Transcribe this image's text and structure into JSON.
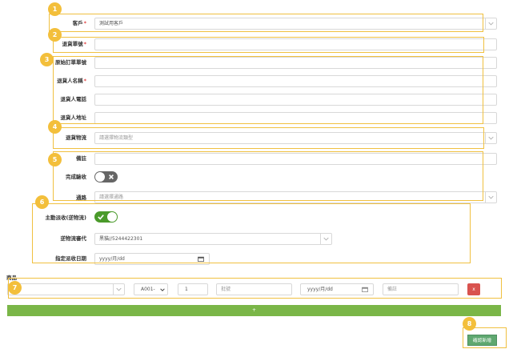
{
  "form": {
    "customer": {
      "label": "客戶",
      "required": "*",
      "value": "測試用客戶"
    },
    "return_no": {
      "label": "退貨單號",
      "required": "*",
      "value": ""
    },
    "original_order_no": {
      "label": "原始訂單單號",
      "value": ""
    },
    "returner_name": {
      "label": "退貨人名稱",
      "required": "*",
      "value": ""
    },
    "returner_phone": {
      "label": "退貨人電話",
      "value": ""
    },
    "returner_address": {
      "label": "退貨人地址",
      "value": ""
    },
    "return_logistics": {
      "label": "退貨物流",
      "placeholder": "請選擇物流類型"
    },
    "note": {
      "label": "備註",
      "value": ""
    },
    "completed": {
      "label": "完成驗收",
      "on": false
    },
    "route": {
      "label": "通路",
      "placeholder": "請選擇通路"
    },
    "auto_pickup": {
      "label": "主動派收(逆物流)",
      "on": true
    },
    "logistics_provider": {
      "label": "逆物流審代",
      "value": "黑貓//5244422301"
    },
    "pickup_date": {
      "label": "指定派收日期",
      "placeholder": "yyyy/月/dd"
    }
  },
  "products": {
    "label": "商品",
    "row": {
      "product_placeholder": "",
      "unit_value": "A001-",
      "quantity": "1",
      "batch_placeholder": "批號",
      "date_placeholder": "yyyy/月/dd",
      "note_placeholder": "備註",
      "delete_label": "x"
    },
    "add_label": "+"
  },
  "actions": {
    "confirm_label": "確認新增"
  },
  "markers": [
    "1",
    "2",
    "3",
    "4",
    "5",
    "6",
    "7",
    "8"
  ],
  "colors": {
    "marker": "#f3bf3b",
    "highlight": "#f0c040",
    "toggle_on": "#4a9a2a",
    "toggle_off": "#666666",
    "add_bar": "#7ab648",
    "delete": "#d9534f",
    "confirm": "#5fa870"
  }
}
